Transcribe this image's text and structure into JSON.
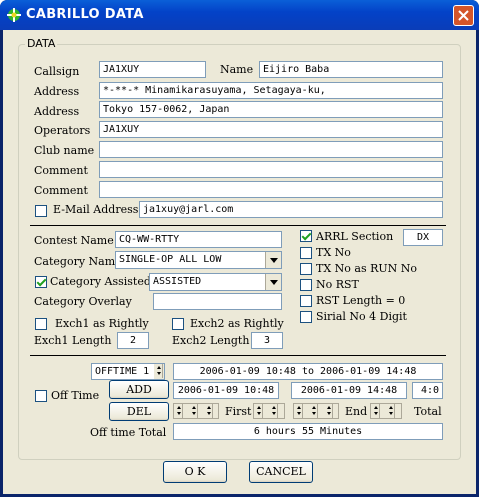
{
  "window": {
    "title": "CABRILLO DATA"
  },
  "data_group": {
    "title": "DATA"
  },
  "station": {
    "callsign_label": "Callsign",
    "callsign": "JA1XUY",
    "name_label": "Name",
    "name": "Eijiro Baba",
    "address_label": "Address",
    "address1": "*-**-* Minamikarasuyama, Setagaya-ku,",
    "address2": "Tokyo 157-0062, Japan",
    "operators_label": "Operators",
    "operators": "JA1XUY",
    "club_label": "Club name",
    "club": "",
    "comment_label": "Comment",
    "comment1": "",
    "comment2": "",
    "email_label": "E-Mail Address",
    "email_checked": false,
    "email": "ja1xuy@jarl.com"
  },
  "contest": {
    "contest_name_label": "Contest Name",
    "contest_name": "CQ-WW-RTTY",
    "category_name_label": "Category Name",
    "category_name": "SINGLE-OP ALL LOW",
    "category_assisted_label": "Category Assisted",
    "category_assisted_checked": true,
    "category_assisted": "ASSISTED",
    "category_overlay_label": "Category Overlay",
    "category_overlay": "",
    "exch1_rightly_label": "Exch1 as Rightly",
    "exch1_rightly_checked": false,
    "exch2_rightly_label": "Exch2 as Rightly",
    "exch2_rightly_checked": false,
    "exch1_length_label": "Exch1 Length",
    "exch1_length": "2",
    "exch2_length_label": "Exch2 Length",
    "exch2_length": "3"
  },
  "options": {
    "arrl_section_label": "ARRL Section",
    "arrl_section_checked": true,
    "arrl_section": "DX",
    "tx_no_label": "TX No",
    "tx_no_checked": false,
    "tx_no_run_label": "TX No as RUN No",
    "tx_no_run_checked": false,
    "no_rst_label": "No RST",
    "no_rst_checked": false,
    "rst_length_label": "RST Length = 0",
    "rst_length_checked": false,
    "serial_label": "Sirial No 4 Digit",
    "serial_checked": false
  },
  "offtime": {
    "label": "Off Time",
    "checked": false,
    "selector": "OFFTIME 1",
    "range": "2006-01-09 10:48 to 2006-01-09 14:48",
    "add_label": "ADD",
    "del_label": "DEL",
    "first_time": "2006-01-09 10:48",
    "end_time": "2006-01-09 14:48",
    "total_value": "4:0",
    "first_label": "First",
    "end_label": "End",
    "total_label": "Total",
    "total_time_label": "Off time Total",
    "total_time": "6 hours  55 Minutes"
  },
  "buttons": {
    "ok": "O K",
    "cancel": "CANCEL"
  },
  "colors": {
    "titlebar": "#0342c8",
    "face": "#ece9d8",
    "close": "#d4552a",
    "border": "#7f9db9"
  }
}
